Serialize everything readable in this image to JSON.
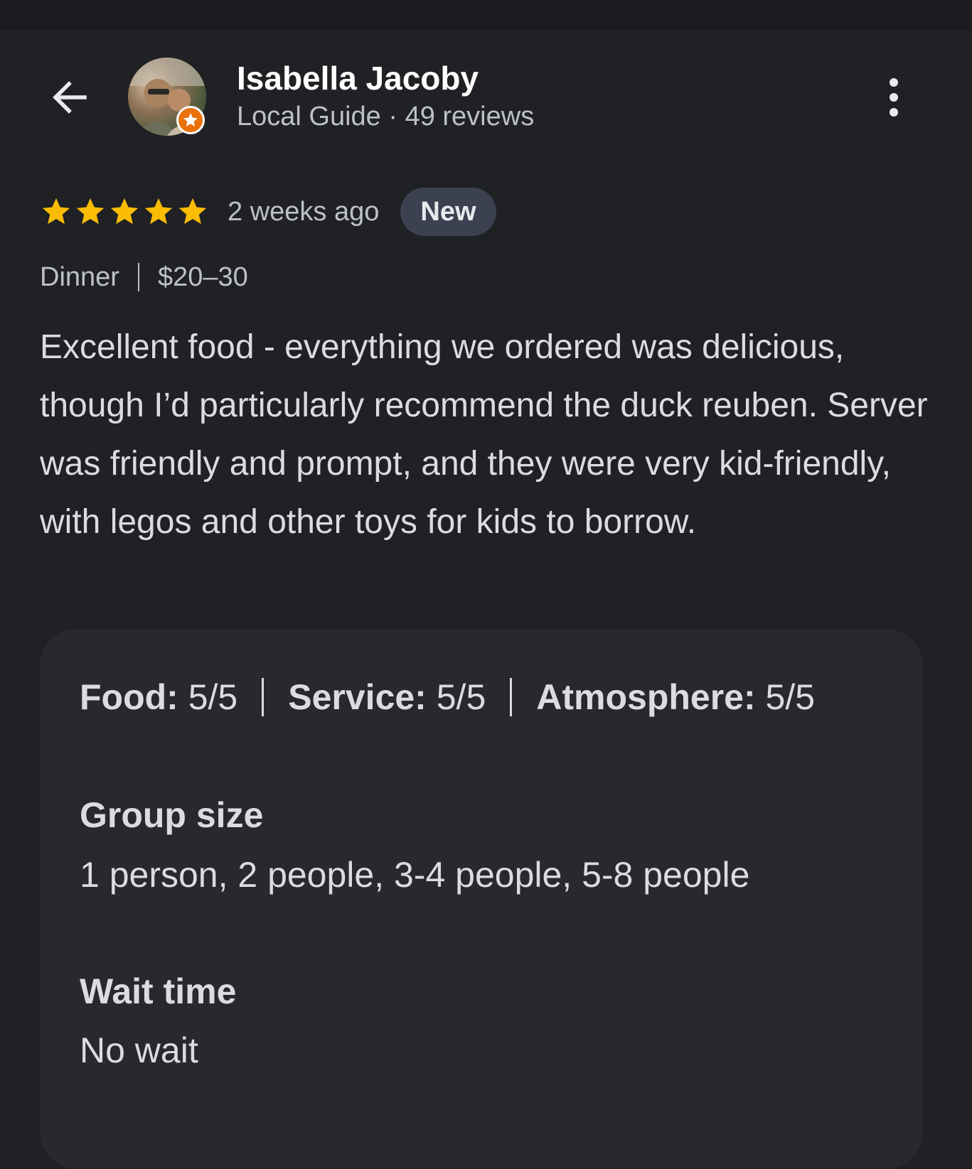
{
  "header": {
    "reviewer_name": "Isabella Jacoby",
    "reviewer_meta": "Local Guide · 49 reviews"
  },
  "review": {
    "rating": 5,
    "max_rating": 5,
    "time_ago": "2 weeks ago",
    "badge": "New",
    "meal": "Dinner",
    "price": "$20–30",
    "text": "Excellent food - everything we ordered was delicious, though I’d particularly recommend the duck reuben. Server was friendly and prompt, and they were very kid-friendly, with legos and other toys for kids to borrow."
  },
  "details": {
    "food_label": "Food:",
    "food_value": "5/5",
    "service_label": "Service:",
    "service_value": "5/5",
    "atmosphere_label": "Atmosphere:",
    "atmosphere_value": "5/5",
    "group_size_heading": "Group size",
    "group_size_value": "1 person, 2 people, 3-4 people, 5-8 people",
    "wait_time_heading": "Wait time",
    "wait_time_value": "No wait"
  },
  "colors": {
    "star": "#fbbc04",
    "badge_orange": "#e8710a",
    "background": "#202124",
    "card": "#28292c"
  },
  "icons": [
    "back-arrow-icon",
    "local-guide-star-icon",
    "star-icon",
    "more-vert-icon"
  ]
}
